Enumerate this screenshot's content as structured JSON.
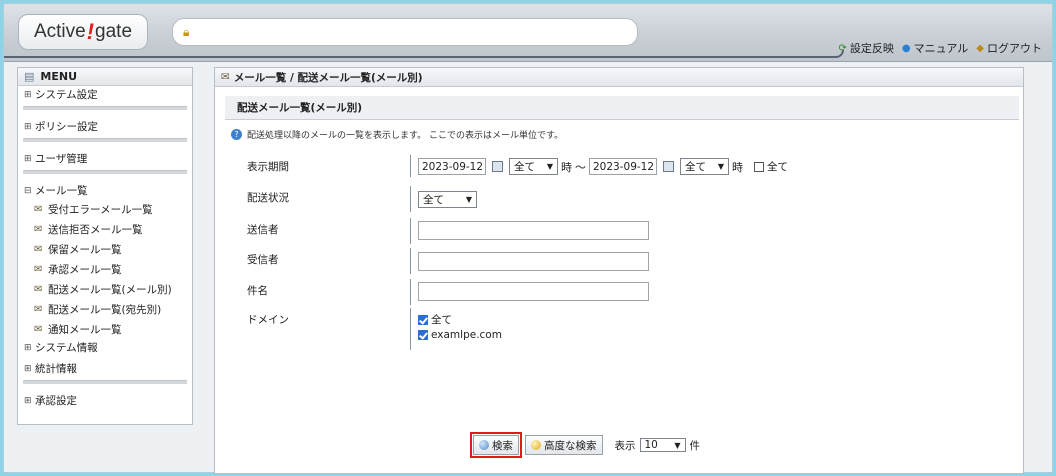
{
  "header": {
    "logo_left": "Active",
    "logo_mark": "!",
    "logo_right": "gate",
    "url_text": "",
    "links": [
      {
        "label": "設定反映",
        "icon": "sync-icon"
      },
      {
        "label": "マニュアル",
        "icon": "help-icon"
      },
      {
        "label": "ログアウト",
        "icon": "logout-icon"
      }
    ]
  },
  "sidebar": {
    "title": "MENU",
    "items": [
      {
        "label": "システム設定",
        "toggle": "⊞"
      },
      {
        "label": "ポリシー設定",
        "toggle": "⊞"
      },
      {
        "label": "ユーザ管理",
        "toggle": "⊞"
      },
      {
        "label": "メール一覧",
        "toggle": "⊟"
      },
      {
        "label": "システム情報",
        "toggle": "⊞"
      },
      {
        "label": "統計情報",
        "toggle": "⊞"
      },
      {
        "label": "承認設定",
        "toggle": "⊞"
      }
    ],
    "mail_sub": [
      {
        "label": "受付エラーメール一覧"
      },
      {
        "label": "送信拒否メール一覧"
      },
      {
        "label": "保留メール一覧"
      },
      {
        "label": "承認メール一覧"
      },
      {
        "label": "配送メール一覧(メール別)"
      },
      {
        "label": "配送メール一覧(宛先別)"
      },
      {
        "label": "通知メール一覧"
      }
    ]
  },
  "main": {
    "breadcrumb": "メール一覧 / 配送メール一覧(メール別)",
    "section_title": "配送メール一覧(メール別)",
    "description": "配送処理以降のメールの一覧を表示します。 ここでの表示はメール単位です。",
    "form": {
      "period_label": "表示期間",
      "date_from": "2023-09-12",
      "hour_from": "全て",
      "hour_unit": "時",
      "tilde": "～",
      "date_to": "2023-09-12",
      "hour_to": "全て",
      "all_label": "全て",
      "status_label": "配送状況",
      "status_value": "全て",
      "sender_label": "送信者",
      "recipient_label": "受信者",
      "subject_label": "件名",
      "domain_label": "ドメイン",
      "domain_options": [
        {
          "label": "全て",
          "checked": true
        },
        {
          "label": "examlpe.com",
          "checked": true
        }
      ]
    },
    "buttons": {
      "search": "検索",
      "advanced": "高度な検索",
      "display_label": "表示",
      "display_count": "10",
      "count_unit": "件"
    }
  }
}
